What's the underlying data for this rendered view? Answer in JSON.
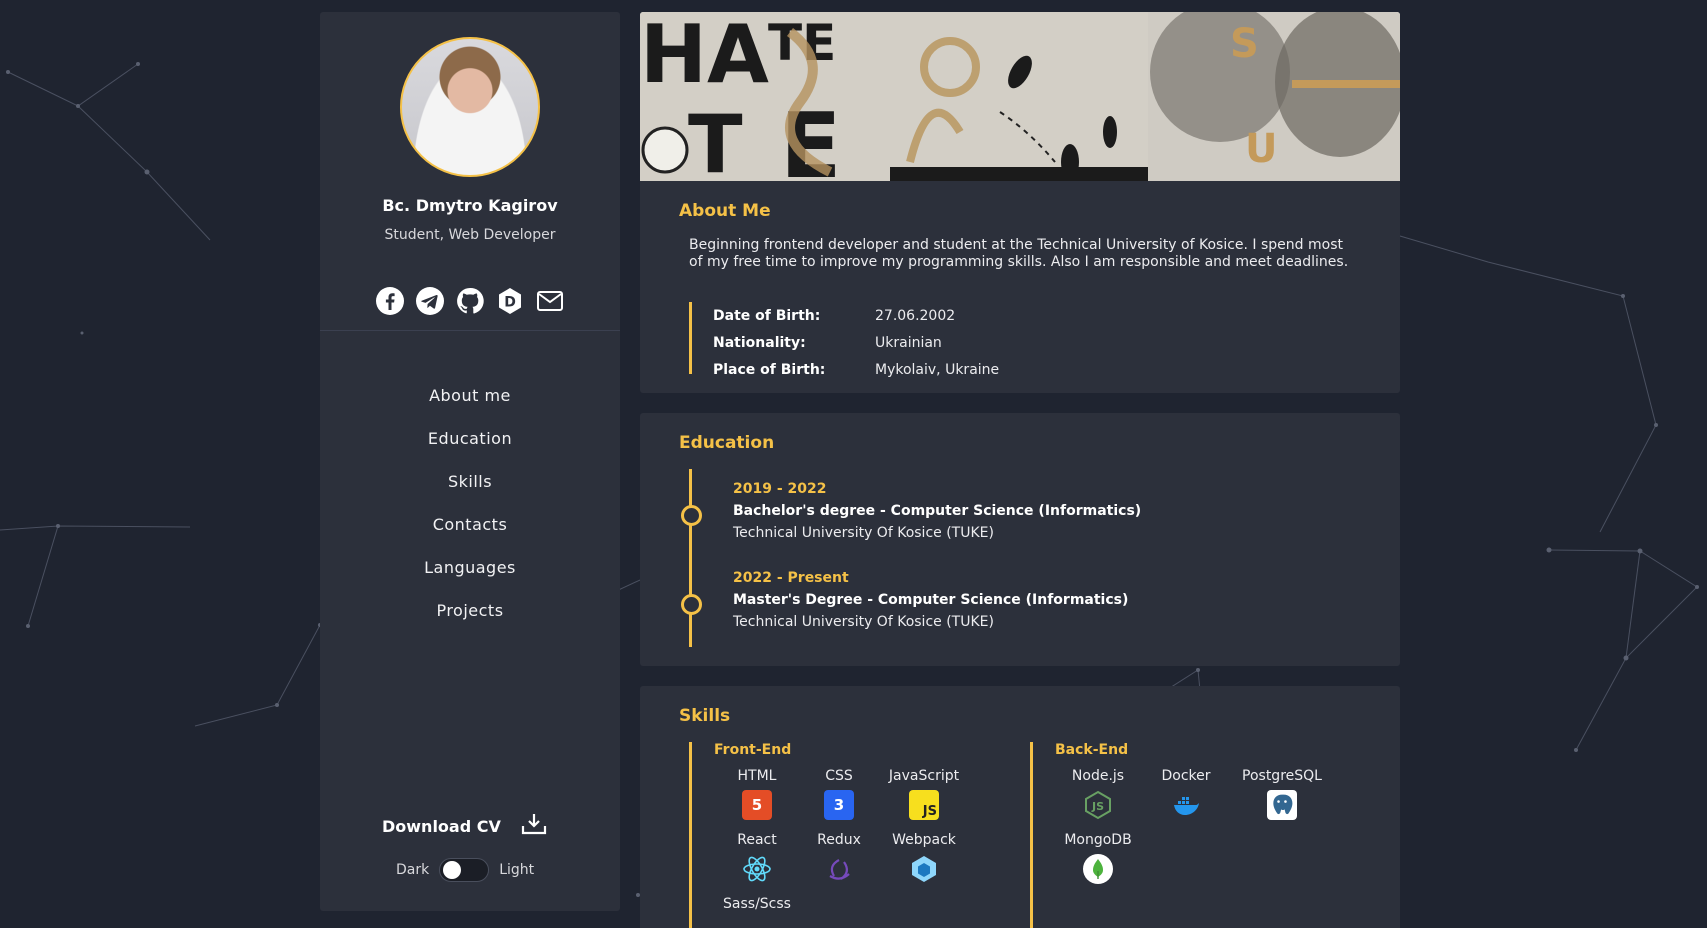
{
  "profile": {
    "name": "Bc. Dmytro Kagirov",
    "role": "Student, Web Developer",
    "socials": [
      "facebook-icon",
      "telegram-icon",
      "github-icon",
      "dev-icon",
      "mail-icon"
    ]
  },
  "nav": {
    "items": [
      {
        "label": "About me"
      },
      {
        "label": "Education"
      },
      {
        "label": "Skills"
      },
      {
        "label": "Contacts"
      },
      {
        "label": "Languages"
      },
      {
        "label": "Projects"
      }
    ]
  },
  "download": {
    "label": "Download CV"
  },
  "theme": {
    "dark_label": "Dark",
    "light_label": "Light",
    "current": "dark"
  },
  "about": {
    "title": "About Me",
    "text": "Beginning frontend developer and student at the Technical University of Kosice. I spend most of my free time to improve my programming skills. Also I am responsible and meet deadlines.",
    "facts": [
      {
        "label": "Date of Birth:",
        "value": "27.06.2002"
      },
      {
        "label": "Nationality:",
        "value": "Ukrainian"
      },
      {
        "label": "Place of Birth:",
        "value": "Mykolaiv, Ukraine"
      }
    ]
  },
  "education": {
    "title": "Education",
    "items": [
      {
        "date": "2019 - 2022",
        "degree": "Bachelor's degree - Computer Science (Informatics)",
        "school": "Technical University Of Kosice (TUKE)"
      },
      {
        "date": "2022 - Present",
        "degree": "Master's Degree - Computer Science (Informatics)",
        "school": "Technical University Of Kosice (TUKE)"
      }
    ]
  },
  "skills": {
    "title": "Skills",
    "frontend": {
      "title": "Front-End",
      "items": [
        {
          "name": "HTML",
          "icon": "html5-icon",
          "color": "#e44d26"
        },
        {
          "name": "CSS",
          "icon": "css3-icon",
          "color": "#2965f1"
        },
        {
          "name": "JavaScript",
          "icon": "javascript-icon",
          "color": "#f7df1e"
        },
        {
          "name": "React",
          "icon": "react-icon",
          "color": "#61dafb"
        },
        {
          "name": "Redux",
          "icon": "redux-icon",
          "color": "#764abc"
        },
        {
          "name": "Webpack",
          "icon": "webpack-icon",
          "color": "#8ed6fb"
        },
        {
          "name": "Sass/Scss",
          "icon": "sass-icon",
          "color": "#cd6799"
        }
      ]
    },
    "backend": {
      "title": "Back-End",
      "items": [
        {
          "name": "Node.js",
          "icon": "nodejs-icon",
          "color": "#68a063"
        },
        {
          "name": "Docker",
          "icon": "docker-icon",
          "color": "#2496ed"
        },
        {
          "name": "PostgreSQL",
          "icon": "postgresql-icon",
          "color": "#336791"
        },
        {
          "name": "MongoDB",
          "icon": "mongodb-icon",
          "color": "#4db33d"
        }
      ]
    }
  },
  "colors": {
    "accent": "#f5c147",
    "panel": "#2c303b",
    "background": "#1f2430"
  }
}
